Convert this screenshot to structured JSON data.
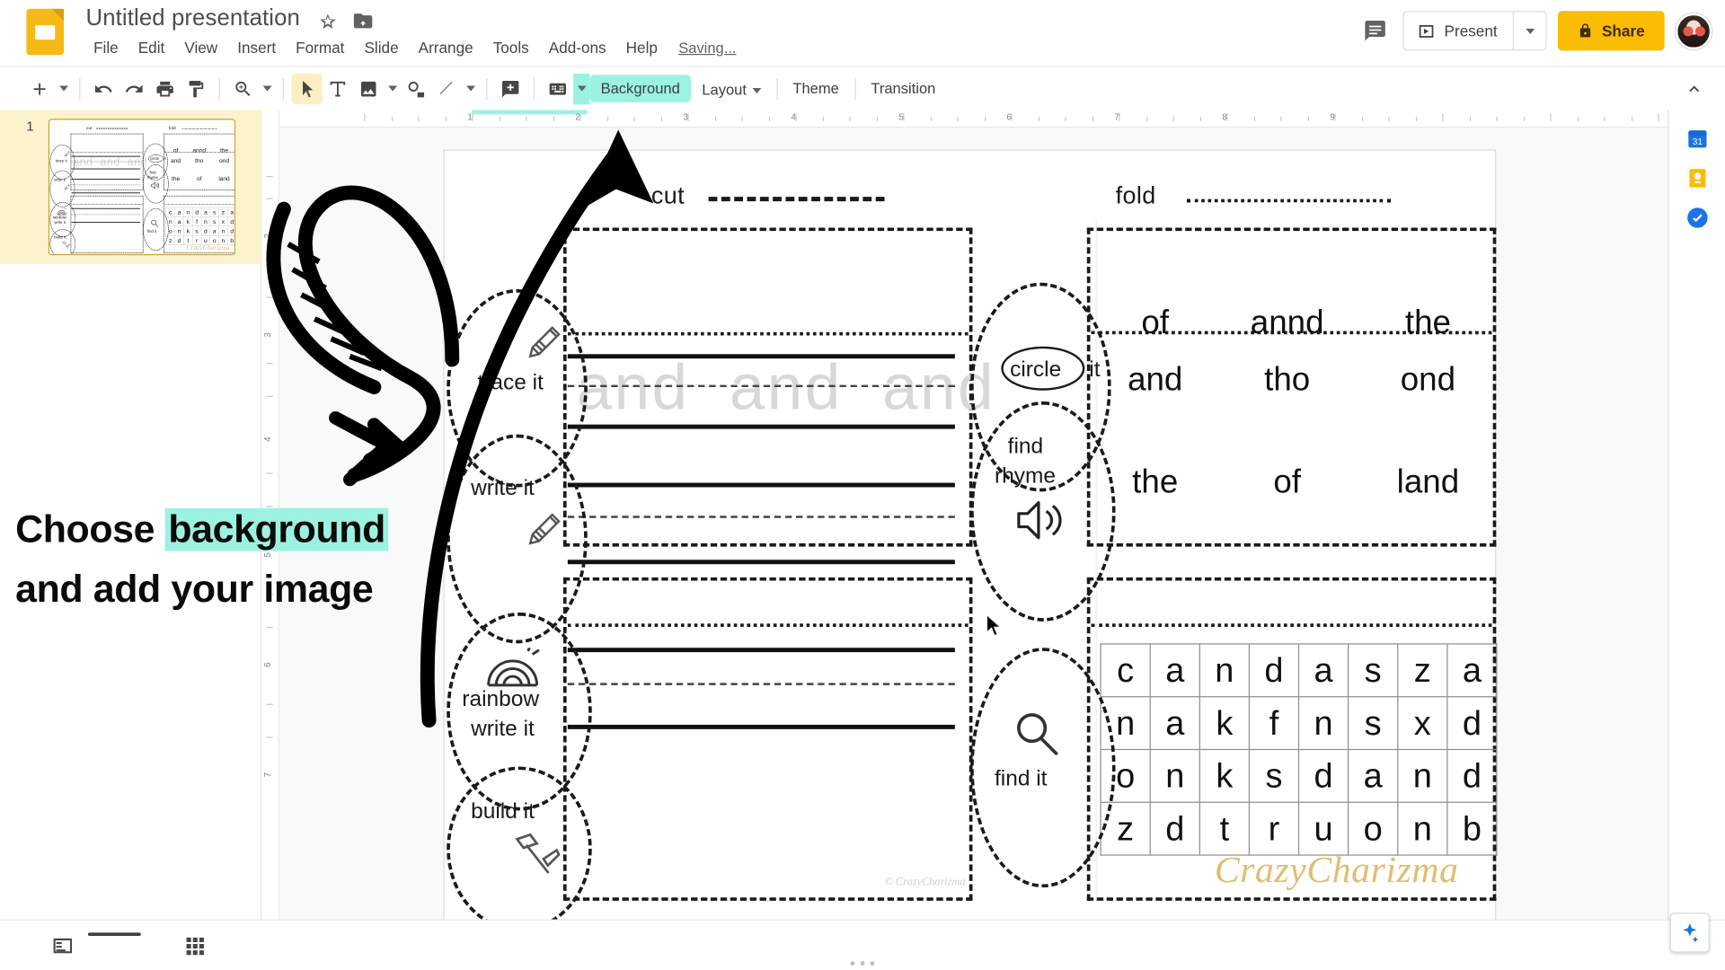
{
  "app": {
    "logo_icon": "slides-logo-icon",
    "title": "Untitled presentation",
    "star_icon": "star-icon",
    "move_to_folder_icon": "move-to-folder-icon",
    "save_status": "Saving...",
    "menus": [
      "File",
      "Edit",
      "View",
      "Insert",
      "Format",
      "Slide",
      "Arrange",
      "Tools",
      "Add-ons",
      "Help"
    ]
  },
  "header_actions": {
    "comment_icon": "comment-icon",
    "present_label": "Present",
    "present_icon": "present-play-icon",
    "present_caret_icon": "chevron-down-icon",
    "share_label": "Share",
    "share_lock_icon": "lock-icon",
    "avatar": "user-avatar"
  },
  "toolbar": {
    "new_slide_icon": "plus-icon",
    "new_slide_caret_icon": "chevron-down-icon",
    "undo_icon": "undo-icon",
    "redo_icon": "redo-icon",
    "print_icon": "print-icon",
    "paint_format_icon": "paint-format-icon",
    "zoom_icon": "zoom-icon",
    "zoom_caret_icon": "chevron-down-icon",
    "select_icon": "cursor-select-icon",
    "textbox_icon": "text-box-icon",
    "image_icon": "image-icon",
    "image_caret_icon": "chevron-down-icon",
    "shape_icon": "shape-icon",
    "line_icon": "line-icon",
    "line_caret_icon": "chevron-down-icon",
    "comment_add_icon": "add-comment-icon",
    "keyboard_icon": "keyboard-icon",
    "keyboard_caret_icon": "chevron-down-icon",
    "background_label": "Background",
    "layout_label": "Layout",
    "layout_caret_icon": "chevron-down-icon",
    "theme_label": "Theme",
    "transition_label": "Transition",
    "collapse_icon": "chevron-up-icon",
    "highlight_color": "#9CF2E0"
  },
  "filmstrip": {
    "slide_number": "1"
  },
  "rulers": {
    "h_numbers": [
      "1",
      "2",
      "3",
      "4",
      "5",
      "6",
      "7",
      "8",
      "9"
    ],
    "v_numbers": [
      "2",
      "3",
      "4",
      "5",
      "6",
      "7"
    ],
    "selection_color": "#9CF2E0"
  },
  "annotation": {
    "line1_pre": "Choose ",
    "line1_hl": "background",
    "line2": "and add your image",
    "highlight_color": "#9CF2E0",
    "arrow_icon": "curved-arrow-up-icon",
    "loop_arrow_icon": "looped-arrow-icon"
  },
  "worksheet": {
    "legend": [
      {
        "label": "cut",
        "style": "dashed"
      },
      {
        "label": "fold",
        "style": "dotted"
      }
    ],
    "tasks": [
      {
        "id": "trace-it",
        "label": "trace it",
        "icon": "pencil-icon"
      },
      {
        "id": "write-it",
        "label": "write it",
        "icon": "pencil-icon"
      },
      {
        "id": "rainbow-write-it",
        "label_line1": "rainbow",
        "label_line2": "write it",
        "icon": "rainbow-icon"
      },
      {
        "id": "build-it",
        "label": "build it",
        "icon": "hammer-icon"
      },
      {
        "id": "circle-it",
        "label_circled": "circle",
        "label_rest": "it"
      },
      {
        "id": "find-rhyme",
        "label_line1": "find",
        "label_line2": "rhyme",
        "icon": "speaker-icon"
      },
      {
        "id": "find-it",
        "label": "find it",
        "icon": "magnifier-icon"
      }
    ],
    "trace_word": "and",
    "trace_repeats": [
      "and",
      "and",
      "and"
    ],
    "word_cards": [
      [
        "of",
        "annd",
        "the"
      ],
      [
        "and",
        "tho",
        "ond"
      ],
      [
        "the",
        "of",
        "land"
      ]
    ],
    "letter_grid": [
      [
        "c",
        "a",
        "n",
        "d",
        "a",
        "s",
        "z",
        "a"
      ],
      [
        "n",
        "a",
        "k",
        "f",
        "n",
        "s",
        "x",
        "d"
      ],
      [
        "o",
        "n",
        "k",
        "s",
        "d",
        "a",
        "n",
        "d"
      ],
      [
        "z",
        "d",
        "t",
        "r",
        "u",
        "o",
        "n",
        "b"
      ]
    ],
    "watermark": "CrazyCharizma",
    "watermark_small": "© CrazyCharizma",
    "watermark_color": "#E0BE6E"
  },
  "right_rail": {
    "calendar_icon": "calendar-icon",
    "calendar_day": "31",
    "keep_icon": "keep-notes-icon",
    "tasks_icon": "tasks-icon",
    "expand_icon": "chevron-left-icon",
    "explore_icon": "explore-icon"
  },
  "bottom_bar": {
    "speaker_notes_icon": "speaker-notes-icon",
    "grid_view_icon": "grid-view-icon"
  }
}
